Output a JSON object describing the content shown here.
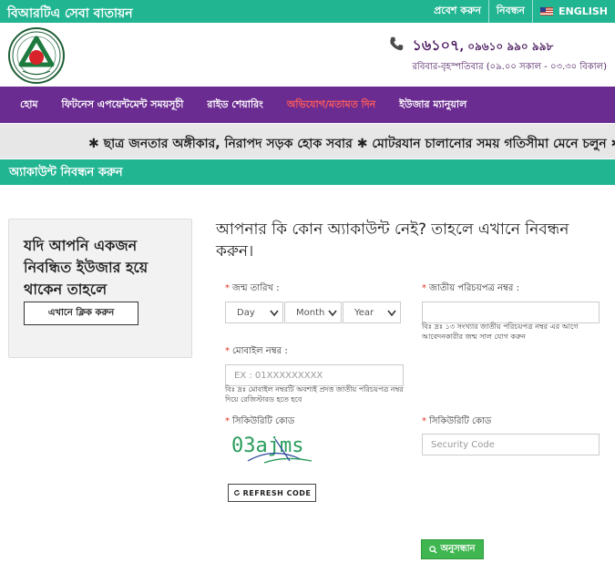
{
  "topbar": {
    "brand": "বিআরটিএ সেবা বাতায়ন",
    "login": "প্রবেশ করুন",
    "register": "নিবন্ধন",
    "language": "ENGLISH"
  },
  "header": {
    "hotline_number": "১৬১০৭",
    "hotline_alt": ", ০৯৬১০ ৯৯০ ৯৯৮",
    "hours": "রবিবার-বৃহস্পতিবার (০৯.০০ সকাল - ০৩.৩০ বিকাল)"
  },
  "nav": {
    "items": [
      {
        "label": "হোম"
      },
      {
        "label": "ফিটনেস এপয়েন্টমেন্ট সময়সূচী"
      },
      {
        "label": "রাইড শেয়ারিং"
      },
      {
        "label": "অভিযোগ/মতামত দিন"
      },
      {
        "label": "ইউজার ম্যানুয়াল"
      }
    ]
  },
  "marquee": {
    "text": "✱ ছাত্র জনতার অঙ্গীকার, নিরাপদ সড়ক হোক সবার ✱ মোটরযান চালানোর সময় গতিসীমা মেনে চলুন ✱"
  },
  "section": {
    "title": "অ্যাকাউন্ট নিবন্ধন করুন"
  },
  "card": {
    "message": "যদি আপনি একজন নিবন্ধিত ইউজার হয়ে থাকেন তাহলে",
    "button": "এখানে ক্লিক করুন"
  },
  "form": {
    "title": "আপনার কি কোন অ্যাকাউন্ট নেই? তাহলে এখানে নিবন্ধন করুন।",
    "dob_label": "জন্ম তারিখ :",
    "day": "Day",
    "month": "Month",
    "year": "Year",
    "nid_label": "জাতীয় পরিচয়পত্র নম্বর :",
    "nid_hint": "বিঃ দ্রঃ ১৩ সংখ্যার জাতীয় পরিচয়পত্র নম্বর এর আগে আবেদনকারীর জন্ম সাল যোগ করুন",
    "mobile_label": "মোবাইল নম্বর :",
    "mobile_placeholder": "EX : 01XXXXXXXXX",
    "mobile_hint": "বিঃ দ্রঃ মোবাইল নম্বরটি অবশ্যই প্রদত্ত জাতীয় পরিচয়পত্র নম্বর দিয়ে রেজিস্টারড হতে হবে",
    "captcha_label": "সিকিউরিটি কোড",
    "captcha_text": "03ajms",
    "refresh": "REFRESH CODE",
    "security_label": "সিকিউরিটি কোড",
    "security_placeholder": "Security Code",
    "submit": "অনুসন্ধান"
  },
  "colors": {
    "green": "#22b592",
    "purple": "#6b2c91",
    "active_nav": "#ff5b5b",
    "submit": "#3fb64f"
  },
  "icons": [
    "us-flag-icon",
    "phone-icon",
    "brta-logo",
    "caret-down-icon",
    "refresh-icon",
    "search-icon"
  ]
}
